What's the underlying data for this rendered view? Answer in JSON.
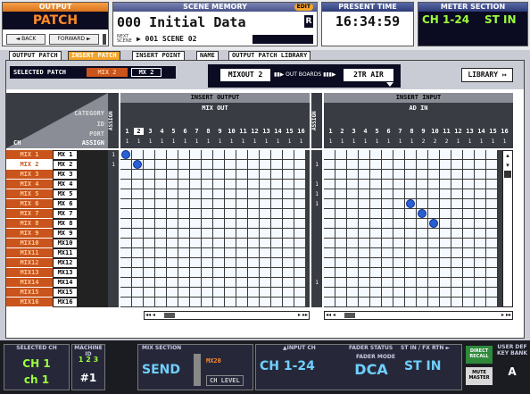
{
  "header": {
    "output_label": "OUTPUT",
    "output_value": "PATCH",
    "back_label": "◄ BACK",
    "forward_label": "FORWARD ►",
    "scene_memory_label": "SCENE MEMORY",
    "edit_badge": "EDIT",
    "scene_number": "000",
    "scene_name": "Initial Data",
    "r_badge": "R",
    "next_label": "NEXT SCENE",
    "next_scene": "▶ 001 SCENE 02",
    "present_time_label": "PRESENT TIME",
    "time": "16:34:59",
    "meter_section_label": "METER SECTION",
    "meter_ch": "CH 1-24",
    "meter_st": "ST IN"
  },
  "tabs": [
    {
      "label": "OUTPUT PATCH",
      "active": false
    },
    {
      "label": "INSERT PATCH",
      "active": true
    },
    {
      "label": "INSERT POINT",
      "active": false
    },
    {
      "label": "NAME",
      "active": false
    },
    {
      "label": "OUTPUT PATCH LIBRARY",
      "active": false
    }
  ],
  "toolbar": {
    "selected_patch_label": "SELECTED PATCH",
    "selected_patch_value": "MIX 2",
    "selected_patch_value2": "MX 2",
    "mixout_label": "MIXOUT 2",
    "boards_label": "OUT BOARDS",
    "air_label": "2TR AIR",
    "library_label": "LIBRARY ↦"
  },
  "grid": {
    "category_label": "CATEGORY",
    "id_label": "ID",
    "port_label": "PORT",
    "ch_label": "CH",
    "assign_label": "ASSIGN",
    "assign_vertical": "ASSIGN",
    "insert_output_title": "INSERT OUTPUT",
    "insert_output_sub": "MIX OUT",
    "insert_input_title": "INSERT INPUT",
    "insert_input_sub": "AD IN",
    "output_ports": [
      "1",
      "2",
      "3",
      "4",
      "5",
      "6",
      "7",
      "8",
      "9",
      "10",
      "11",
      "12",
      "13",
      "14",
      "15",
      "16"
    ],
    "output_ids": [
      "1",
      "1",
      "1",
      "1",
      "1",
      "1",
      "1",
      "1",
      "1",
      "1",
      "1",
      "1",
      "1",
      "1",
      "1",
      "1"
    ],
    "input_ports": [
      "1",
      "2",
      "3",
      "4",
      "5",
      "6",
      "7",
      "8",
      "9",
      "10",
      "11",
      "12",
      "13",
      "14",
      "15",
      "16"
    ],
    "input_ids": [
      "1",
      "1",
      "1",
      "1",
      "1",
      "1",
      "1",
      "1",
      "2",
      "2",
      "2",
      "1",
      "1",
      "1",
      "1",
      "1"
    ],
    "rows": [
      {
        "ch": "MIX 1",
        "mx": "MX 1",
        "out_assign": "1",
        "in_assign": ""
      },
      {
        "ch": "MIX 2",
        "mx": "MX 2",
        "out_assign": "1",
        "in_assign": "1"
      },
      {
        "ch": "MIX 3",
        "mx": "MX 3",
        "out_assign": "",
        "in_assign": ""
      },
      {
        "ch": "MIX 4",
        "mx": "MX 4",
        "out_assign": "",
        "in_assign": "1"
      },
      {
        "ch": "MIX 5",
        "mx": "MX 5",
        "out_assign": "",
        "in_assign": "1"
      },
      {
        "ch": "MIX 6",
        "mx": "MX 6",
        "out_assign": "",
        "in_assign": "1"
      },
      {
        "ch": "MIX 7",
        "mx": "MX 7",
        "out_assign": "",
        "in_assign": ""
      },
      {
        "ch": "MIX 8",
        "mx": "MX 8",
        "out_assign": "",
        "in_assign": ""
      },
      {
        "ch": "MIX 9",
        "mx": "MX 9",
        "out_assign": "",
        "in_assign": ""
      },
      {
        "ch": "MIX10",
        "mx": "MX10",
        "out_assign": "",
        "in_assign": ""
      },
      {
        "ch": "MIX11",
        "mx": "MX11",
        "out_assign": "",
        "in_assign": ""
      },
      {
        "ch": "MIX12",
        "mx": "MX12",
        "out_assign": "",
        "in_assign": ""
      },
      {
        "ch": "MIX13",
        "mx": "MX13",
        "out_assign": "",
        "in_assign": ""
      },
      {
        "ch": "MIX14",
        "mx": "MX14",
        "out_assign": "",
        "in_assign": "1"
      },
      {
        "ch": "MIX15",
        "mx": "MX15",
        "out_assign": "",
        "in_assign": ""
      },
      {
        "ch": "MIX16",
        "mx": "MX16",
        "out_assign": "",
        "in_assign": ""
      }
    ],
    "output_patches": [
      {
        "row": 1,
        "port": 1
      },
      {
        "row": 2,
        "port": 2
      }
    ],
    "input_patches": [
      {
        "row": 6,
        "port": 8
      },
      {
        "row": 7,
        "port": 9
      },
      {
        "row": 8,
        "port": 10
      }
    ],
    "selected_row": 2,
    "selected_output_port": 2
  },
  "footer": {
    "selected_ch_label": "SELECTED CH",
    "selected_ch": "CH 1",
    "selected_ch_name": "ch 1",
    "machine_id_label": "MACHINE ID",
    "machine_id_digits": "1 2 3",
    "machine_id": "#1",
    "mix_section_label": "MIX SECTION",
    "send_label": "SEND",
    "mix_name": "MX20",
    "ch_level_label": "CH LEVEL",
    "input_ch_label": "▲INPUT CH",
    "input_ch": "CH 1-24",
    "fader_status_label": "FADER STATUS",
    "fader_mode_label": "FADER MODE",
    "fader_mode": "DCA",
    "st_in_label": "ST IN / FX RTN ►",
    "st_in": "ST IN",
    "direct_recall": "DIRECT RECALL",
    "mute_master": "MUTE MASTER",
    "user_def_label": "USER DEF KEY BANK",
    "user_def_value": "A"
  }
}
